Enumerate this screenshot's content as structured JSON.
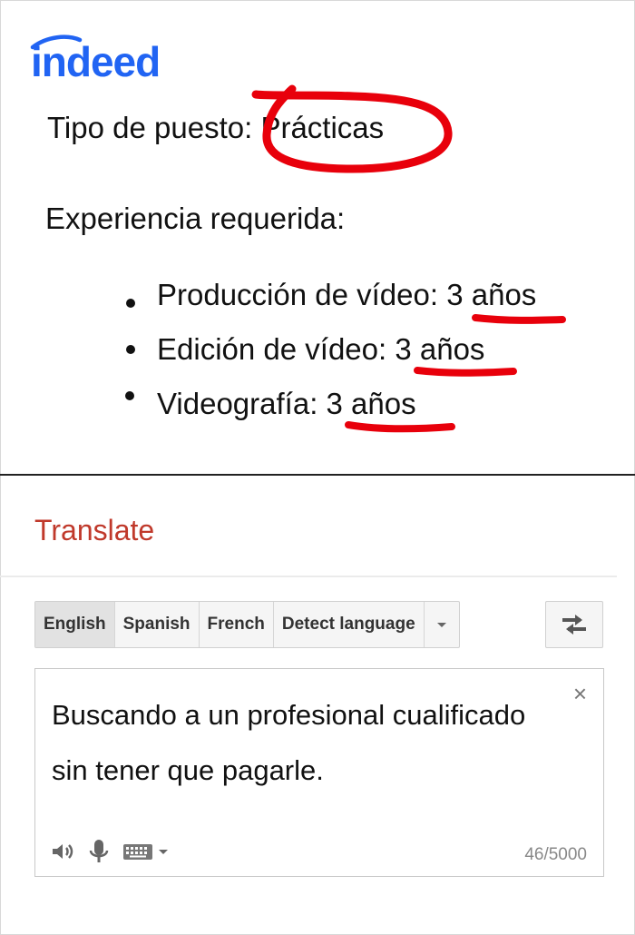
{
  "indeed": {
    "logo_text": "indeed",
    "job_type_label": "Tipo de puesto:",
    "job_type_value": "Prácticas",
    "experience_label": "Experiencia requerida:",
    "experience_items": [
      {
        "label": "Producción de vídeo:",
        "value": "3 años"
      },
      {
        "label": "Edición de vídeo:",
        "value": "3 años"
      },
      {
        "label": "Videografía:",
        "value": "3 años"
      }
    ]
  },
  "translate": {
    "title": "Translate",
    "languages": [
      "English",
      "Spanish",
      "French",
      "Detect language"
    ],
    "active_language": "English",
    "source_text": "Buscando a un profesional cualificado sin tener que pagarle.",
    "char_count": "46/5000",
    "clear_label": "×"
  },
  "icons": [
    "speaker-icon",
    "microphone-icon",
    "keyboard-icon",
    "chevron-down-icon",
    "swap-icon",
    "close-icon"
  ],
  "colors": {
    "indeed_blue": "#2164f3",
    "annotation_red": "#e8000b",
    "translate_title": "#c0392b"
  }
}
